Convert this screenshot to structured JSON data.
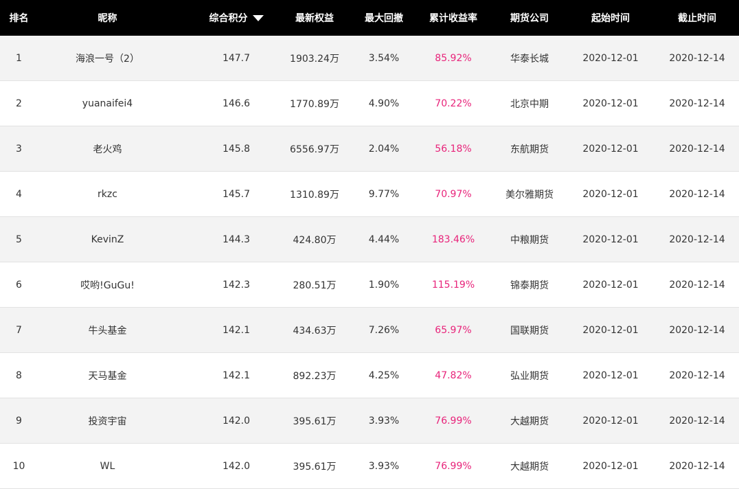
{
  "columns": {
    "rank": "排名",
    "nickname": "昵称",
    "score": "综合积分",
    "equity": "最新权益",
    "drawdown": "最大回撤",
    "return": "累计收益率",
    "company": "期货公司",
    "start": "起始时间",
    "end": "截止时间"
  },
  "sort": {
    "column": "score",
    "direction": "descending",
    "icon": "triangle-down-icon"
  },
  "colors": {
    "header_bg": "#000000",
    "return_text": "#e8237a",
    "odd_row": "#f3f3f3",
    "even_row": "#ffffff"
  },
  "rows": [
    {
      "rank": "1",
      "nickname": "海浪一号（2）",
      "score": "147.7",
      "equity": "1903.24万",
      "drawdown": "3.54%",
      "return": "85.92%",
      "company": "华泰长城",
      "start": "2020-12-01",
      "end": "2020-12-14"
    },
    {
      "rank": "2",
      "nickname": "yuanaifei4",
      "score": "146.6",
      "equity": "1770.89万",
      "drawdown": "4.90%",
      "return": "70.22%",
      "company": "北京中期",
      "start": "2020-12-01",
      "end": "2020-12-14"
    },
    {
      "rank": "3",
      "nickname": "老火鸡",
      "score": "145.8",
      "equity": "6556.97万",
      "drawdown": "2.04%",
      "return": "56.18%",
      "company": "东航期货",
      "start": "2020-12-01",
      "end": "2020-12-14"
    },
    {
      "rank": "4",
      "nickname": "rkzc",
      "score": "145.7",
      "equity": "1310.89万",
      "drawdown": "9.77%",
      "return": "70.97%",
      "company": "美尔雅期货",
      "start": "2020-12-01",
      "end": "2020-12-14"
    },
    {
      "rank": "5",
      "nickname": "KevinZ",
      "score": "144.3",
      "equity": "424.80万",
      "drawdown": "4.44%",
      "return": "183.46%",
      "company": "中粮期货",
      "start": "2020-12-01",
      "end": "2020-12-14"
    },
    {
      "rank": "6",
      "nickname": "哎哟!GuGu!",
      "score": "142.3",
      "equity": "280.51万",
      "drawdown": "1.90%",
      "return": "115.19%",
      "company": "锦泰期货",
      "start": "2020-12-01",
      "end": "2020-12-14"
    },
    {
      "rank": "7",
      "nickname": "牛头基金",
      "score": "142.1",
      "equity": "434.63万",
      "drawdown": "7.26%",
      "return": "65.97%",
      "company": "国联期货",
      "start": "2020-12-01",
      "end": "2020-12-14"
    },
    {
      "rank": "8",
      "nickname": "天马基金",
      "score": "142.1",
      "equity": "892.23万",
      "drawdown": "4.25%",
      "return": "47.82%",
      "company": "弘业期货",
      "start": "2020-12-01",
      "end": "2020-12-14"
    },
    {
      "rank": "9",
      "nickname": "投资宇宙",
      "score": "142.0",
      "equity": "395.61万",
      "drawdown": "3.93%",
      "return": "76.99%",
      "company": "大越期货",
      "start": "2020-12-01",
      "end": "2020-12-14"
    },
    {
      "rank": "10",
      "nickname": "WL",
      "score": "142.0",
      "equity": "395.61万",
      "drawdown": "3.93%",
      "return": "76.99%",
      "company": "大越期货",
      "start": "2020-12-01",
      "end": "2020-12-14"
    }
  ]
}
